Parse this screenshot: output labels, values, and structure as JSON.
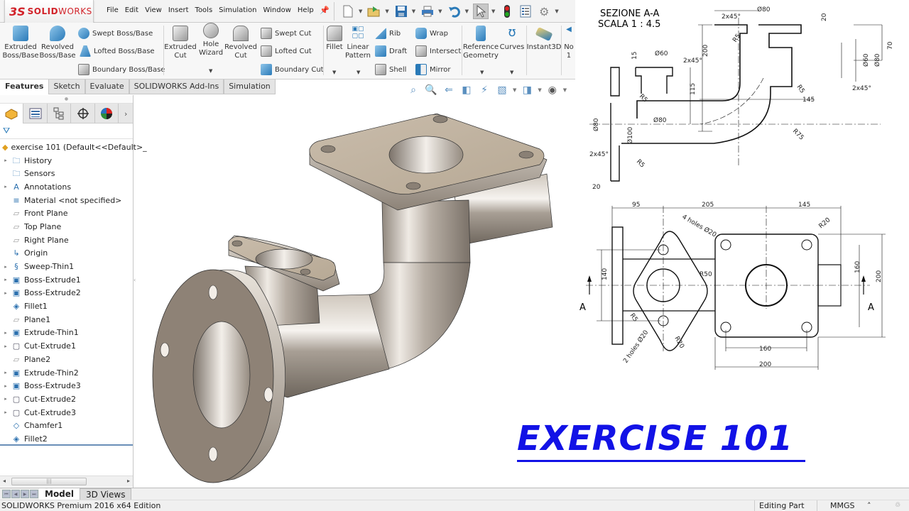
{
  "app": {
    "logo": {
      "mark": "3S",
      "brand_bold": "SOLID",
      "brand_light": "WORKS"
    },
    "menu": [
      "File",
      "Edit",
      "View",
      "Insert",
      "Tools",
      "Simulation",
      "Window",
      "Help"
    ],
    "quick_access": [
      {
        "name": "new-document-icon",
        "glyph": "🗋"
      },
      {
        "name": "open-icon",
        "glyph": "📂"
      },
      {
        "name": "save-icon",
        "glyph": "💾"
      },
      {
        "name": "print-icon",
        "glyph": "🖶"
      },
      {
        "name": "undo-icon",
        "glyph": "↶"
      },
      {
        "name": "select-icon",
        "glyph": "⇖"
      },
      {
        "name": "rebuild-icon",
        "glyph": "●"
      },
      {
        "name": "file-properties-icon",
        "glyph": "☰"
      },
      {
        "name": "options-gear-icon",
        "glyph": "⚙"
      }
    ]
  },
  "ribbon": {
    "extruded_boss": "Extruded\nBoss/Base",
    "revolved_boss": "Revolved\nBoss/Base",
    "swept_boss": "Swept Boss/Base",
    "lofted_boss": "Lofted Boss/Base",
    "boundary_boss": "Boundary Boss/Base",
    "extruded_cut": "Extruded\nCut",
    "hole_wizard": "Hole\nWizard",
    "revolved_cut": "Revolved\nCut",
    "swept_cut": "Swept Cut",
    "lofted_cut": "Lofted Cut",
    "boundary_cut": "Boundary Cut",
    "fillet": "Fillet",
    "linear_pattern": "Linear\nPattern",
    "rib": "Rib",
    "draft": "Draft",
    "shell": "Shell",
    "wrap": "Wrap",
    "intersect": "Intersect",
    "mirror": "Mirror",
    "reference_geometry": "Reference\nGeometry",
    "curves": "Curves",
    "instant3d": "Instant3D",
    "truncated": "No\n1"
  },
  "command_tabs": [
    "Features",
    "Sketch",
    "Evaluate",
    "SOLIDWORKS Add-Ins",
    "Simulation"
  ],
  "active_command_tab": "Features",
  "feature_manager": {
    "tabs": [
      "feature-manager-tab",
      "property-manager-tab",
      "configuration-manager-tab",
      "dimxpert-manager-tab",
      "display-manager-tab"
    ],
    "root": "exercise 101  (Default<<Default>_",
    "items": [
      {
        "label": "History",
        "icon": "history-folder-icon",
        "glyph": "🗀",
        "expandable": true
      },
      {
        "label": "Sensors",
        "icon": "sensors-folder-icon",
        "glyph": "🗀",
        "expandable": false
      },
      {
        "label": "Annotations",
        "icon": "annotations-folder-icon",
        "glyph": "A",
        "expandable": true
      },
      {
        "label": "Material <not specified>",
        "icon": "material-icon",
        "glyph": "≡",
        "expandable": false
      },
      {
        "label": "Front Plane",
        "icon": "plane-icon",
        "glyph": "▱",
        "expandable": false
      },
      {
        "label": "Top Plane",
        "icon": "plane-icon",
        "glyph": "▱",
        "expandable": false
      },
      {
        "label": "Right Plane",
        "icon": "plane-icon",
        "glyph": "▱",
        "expandable": false
      },
      {
        "label": "Origin",
        "icon": "origin-icon",
        "glyph": "↳",
        "expandable": false
      },
      {
        "label": "Sweep-Thin1",
        "icon": "sweep-icon",
        "glyph": "§",
        "expandable": true
      },
      {
        "label": "Boss-Extrude1",
        "icon": "boss-extrude-icon",
        "glyph": "▣",
        "expandable": true
      },
      {
        "label": "Boss-Extrude2",
        "icon": "boss-extrude-icon",
        "glyph": "▣",
        "expandable": true
      },
      {
        "label": "Fillet1",
        "icon": "fillet-icon",
        "glyph": "◈",
        "expandable": false
      },
      {
        "label": "Plane1",
        "icon": "plane-icon",
        "glyph": "▱",
        "expandable": false
      },
      {
        "label": "Extrude-Thin1",
        "icon": "boss-extrude-icon",
        "glyph": "▣",
        "expandable": true
      },
      {
        "label": "Cut-Extrude1",
        "icon": "cut-extrude-icon",
        "glyph": "▢",
        "expandable": true
      },
      {
        "label": "Plane2",
        "icon": "plane-icon",
        "glyph": "▱",
        "expandable": false
      },
      {
        "label": "Extrude-Thin2",
        "icon": "boss-extrude-icon",
        "glyph": "▣",
        "expandable": true
      },
      {
        "label": "Boss-Extrude3",
        "icon": "boss-extrude-icon",
        "glyph": "▣",
        "expandable": true
      },
      {
        "label": "Cut-Extrude2",
        "icon": "cut-extrude-icon",
        "glyph": "▢",
        "expandable": true
      },
      {
        "label": "Cut-Extrude3",
        "icon": "cut-extrude-icon",
        "glyph": "▢",
        "expandable": true
      },
      {
        "label": "Chamfer1",
        "icon": "chamfer-icon",
        "glyph": "◇",
        "expandable": false
      },
      {
        "label": "Fillet2",
        "icon": "fillet-icon",
        "glyph": "◈",
        "expandable": false
      }
    ]
  },
  "bottom_tabs": [
    "Model",
    "3D Views"
  ],
  "active_bottom_tab": "Model",
  "status": {
    "edition": "SOLIDWORKS Premium 2016 x64 Edition",
    "mode": "Editing Part",
    "units": "MMGS",
    "units_caret": "˄"
  },
  "drawing": {
    "section_title": "SEZIONE A-A",
    "scale": "SCALA 1 : 4.5",
    "section_dims": {
      "chamfer_top": "2x45°",
      "d80_top": "Ø80",
      "d20": "20",
      "d200": "200",
      "d70": "70",
      "r5_a": "R5",
      "d15": "15",
      "d60_small": "Ø60",
      "chamfer_small": "2x45°",
      "d115": "115",
      "d60_right": "Ø60",
      "d80_right": "Ø80",
      "r5_b": "R5",
      "chamfer_right": "2x45°",
      "d145": "145",
      "r5_c": "R5",
      "d80_left": "Ø80",
      "d80_mid": "Ø80",
      "d100": "Ø100",
      "r75": "R75",
      "chamfer_left": "2x45°",
      "r5_d": "R5",
      "d20_bottom": "20"
    },
    "plan_dims": {
      "d95": "95",
      "d205": "205",
      "d145": "145",
      "holes4": "4 holes Ø20",
      "r20_a": "R20",
      "d140": "140",
      "r50": "R50",
      "d160_v": "160",
      "d200_v": "200",
      "section_mark": "A",
      "r5": "R5",
      "holes2": "2 holes Ø20",
      "r20_b": "R20",
      "d160_h": "160",
      "d200_h": "200"
    }
  },
  "overlay_title": "EXERCISE 101"
}
